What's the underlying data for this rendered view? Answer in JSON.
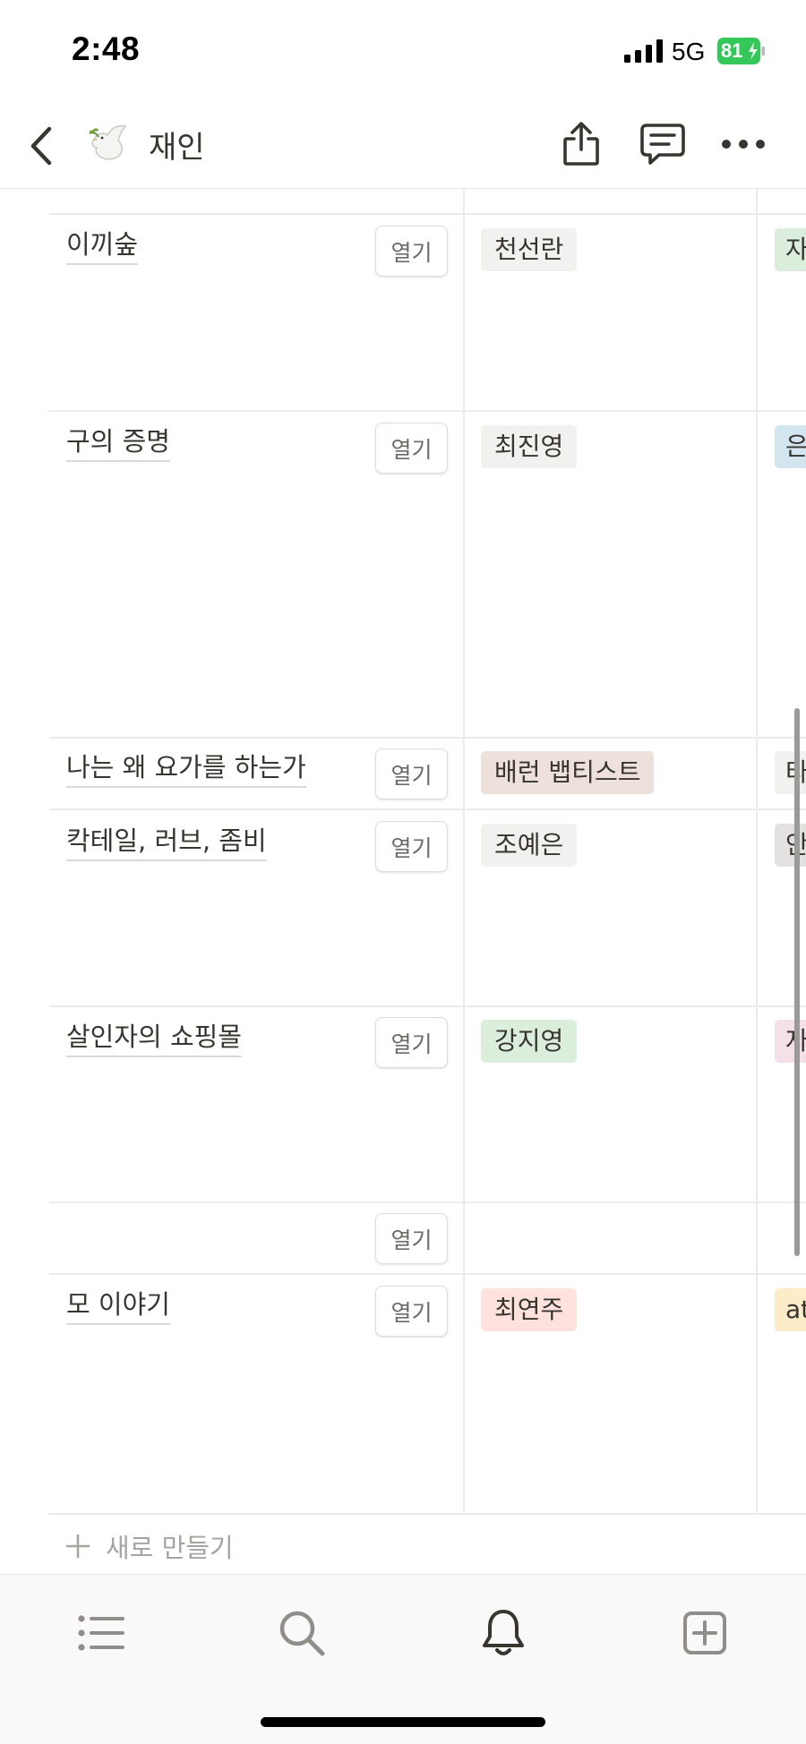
{
  "status_bar": {
    "time": "2:48",
    "network": "5G",
    "battery": "81"
  },
  "nav": {
    "title": "재인",
    "icons": {
      "back": "chevron-left-icon",
      "emoji": "dove-emoji",
      "share": "share-icon",
      "comment": "comment-icon",
      "more": "ellipsis-icon"
    }
  },
  "table": {
    "open_label": "열기",
    "rows": [
      {
        "title": "이끼숲",
        "tag": "천선란",
        "tag_color": "#f1f1ef",
        "next_tag": "자",
        "next_color": "#dbeddb"
      },
      {
        "title": "구의 증명",
        "tag": "최진영",
        "tag_color": "#f1f1ef",
        "next_tag": "은",
        "next_color": "#d3e5ef"
      },
      {
        "title": "나는 왜 요가를 하는가",
        "tag": "배런 뱁티스트",
        "tag_color": "#eee0da",
        "next_tag": "타",
        "next_color": "#f1f1ef"
      },
      {
        "title": "칵테일, 러브, 좀비",
        "tag": "조예은",
        "tag_color": "#f1f1ef",
        "next_tag": "안",
        "next_color": "#e3e2e0"
      },
      {
        "title": "살인자의 쇼핑몰",
        "tag": "강지영",
        "tag_color": "#dbeddb",
        "next_tag": "자",
        "next_color": "#f5e0e9"
      },
      {
        "title": "",
        "tag": "",
        "tag_color": "",
        "next_tag": "",
        "next_color": ""
      },
      {
        "title": "모 이야기",
        "tag": "최연주",
        "tag_color": "#ffe2dd",
        "next_tag": "at",
        "next_color": "#fdecc8"
      }
    ],
    "new_label": "새로 만들기"
  },
  "tab_bar": {
    "icons": [
      "list-icon",
      "search-icon",
      "bell-icon",
      "new-page-icon"
    ]
  }
}
